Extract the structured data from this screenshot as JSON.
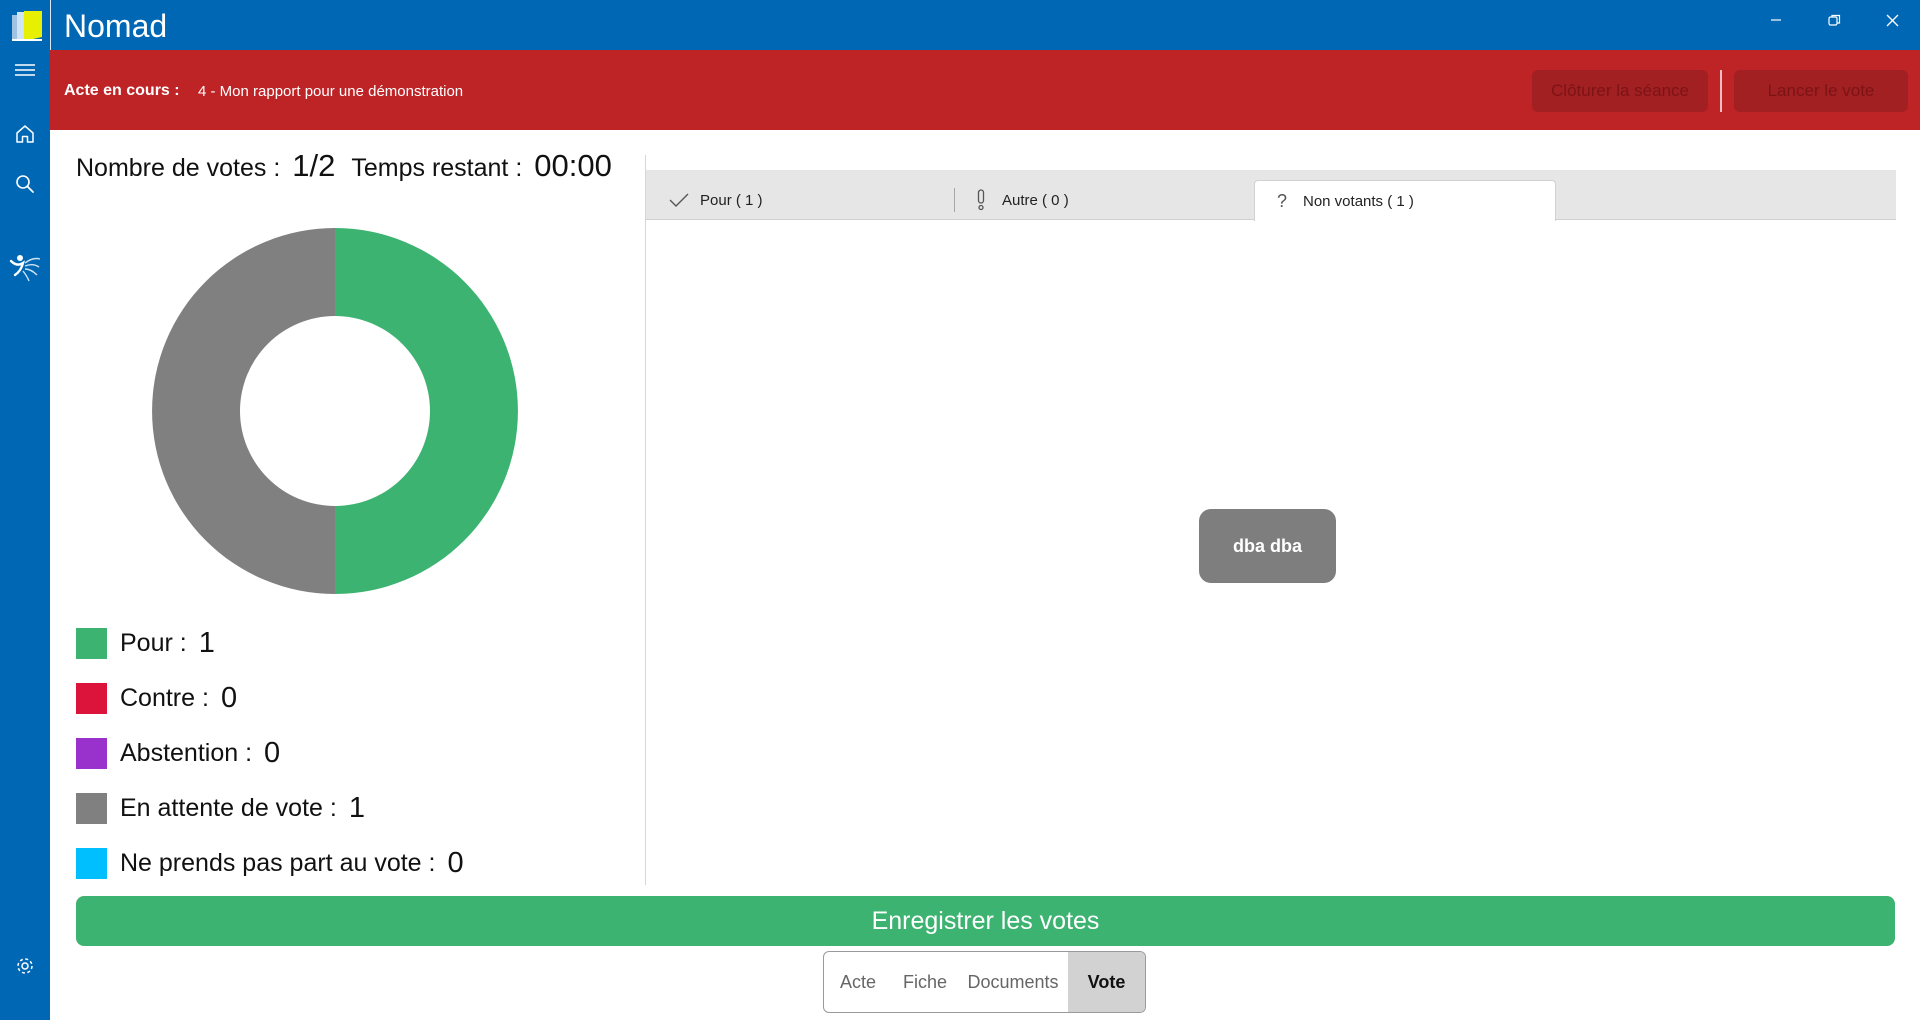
{
  "window": {
    "title": "Nomad",
    "minimize_icon": "minimize-icon",
    "restore_icon": "restore-icon",
    "close_icon": "close-icon",
    "title_color": "#0067B4"
  },
  "sidebar": {
    "items": [
      {
        "icon": "hamburger-menu-icon"
      },
      {
        "icon": "home-icon"
      },
      {
        "icon": "search-icon"
      },
      {
        "icon": "organization-logo-icon"
      },
      {
        "icon": "gear-icon"
      }
    ]
  },
  "act_bar": {
    "label": "Acte en cours :",
    "value": "4 - Mon rapport pour une démonstration",
    "close_session_label": "Clôturer la séance",
    "launch_vote_label": "Lancer le vote",
    "color": "#BE2326"
  },
  "summary": {
    "votes_label": "Nombre de votes :",
    "votes_value": "1/2",
    "time_label": "Temps restant :",
    "time_value": "00:00"
  },
  "chart_data": {
    "type": "pie",
    "donut": true,
    "slices": [
      {
        "label": "Pour",
        "value": 1,
        "color": "#3CB371"
      },
      {
        "label": "En attente de vote",
        "value": 1,
        "color": "#808080"
      }
    ]
  },
  "legend": [
    {
      "label": "Pour :",
      "value": "1",
      "color": "#3CB371"
    },
    {
      "label": "Contre :",
      "value": "0",
      "color": "#DC143C"
    },
    {
      "label": "Abstention :",
      "value": "0",
      "color": "#9932CC"
    },
    {
      "label": "En attente de vote :",
      "value": "1",
      "color": "#808080"
    },
    {
      "label": "Ne prends pas part au vote :",
      "value": "0",
      "color": "#00BFFF"
    }
  ],
  "tabs": [
    {
      "label": "Pour ( 1 )",
      "icon": "checkmark-icon"
    },
    {
      "label": "Autre ( 0 )",
      "icon": "exclamation-icon"
    },
    {
      "label": "Non votants ( 1 )",
      "icon": "question-icon",
      "selected": true
    }
  ],
  "non_voters": [
    {
      "name": "dba dba"
    }
  ],
  "save_button": {
    "label": "Enregistrer les votes",
    "color": "#3CB371"
  },
  "bottom_nav": {
    "items": [
      "Acte",
      "Fiche",
      "Documents",
      "Vote"
    ],
    "selected": "Vote"
  }
}
